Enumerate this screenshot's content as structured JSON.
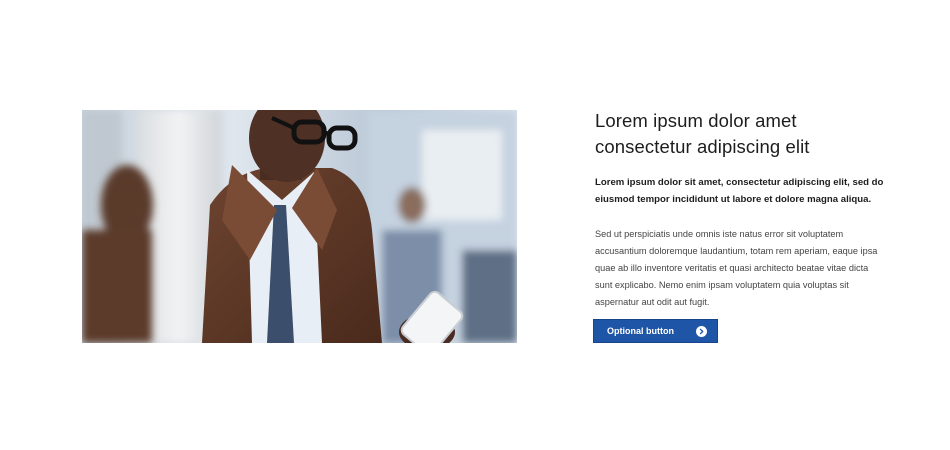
{
  "card": {
    "title": "Lorem ipsum dolor amet consectetur adipiscing elit",
    "lead": "Lorem ipsum dolor sit amet, consectetur adipiscing elit, sed do eiusmod tempor incididunt ut labore et dolore magna aliqua.",
    "body": "Sed ut perspiciatis unde omnis iste natus error sit voluptatem accusantium doloremque laudantium, totam rem aperiam, eaque ipsa quae ab illo inventore veritatis et quasi architecto beatae vitae dicta sunt explicabo. Nemo enim ipsam voluptatem quia voluptas sit aspernatur aut odit aut fugit.",
    "button_label": "Optional button",
    "button_icon": "chevron-right-circle-icon"
  },
  "colors": {
    "button_bg": "#1e55a6",
    "text": "#1d1d1d"
  }
}
